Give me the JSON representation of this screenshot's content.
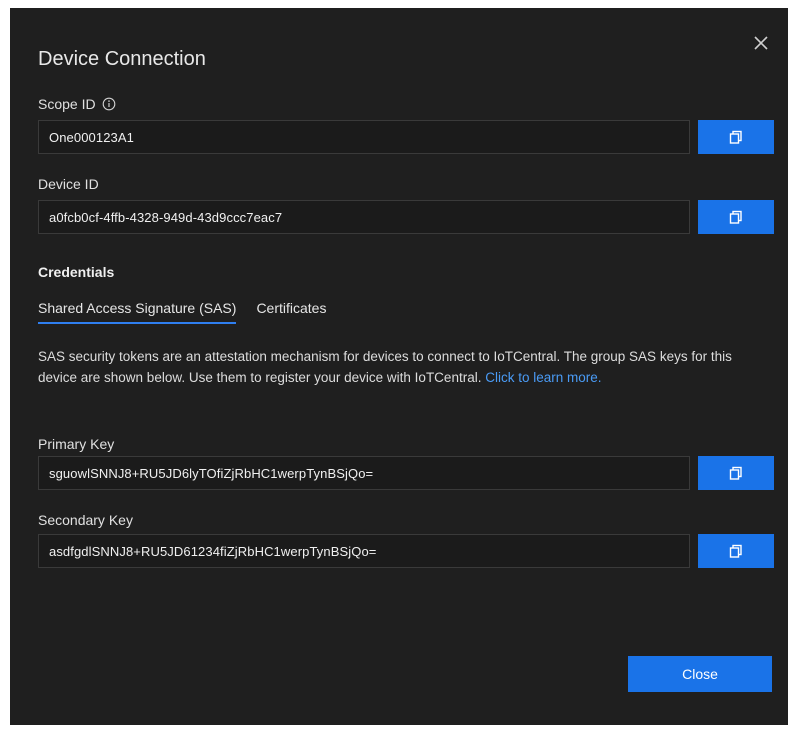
{
  "dialog": {
    "title": "Device Connection",
    "close_icon": "close-icon",
    "accent_color": "#1a73e8"
  },
  "scope": {
    "label": "Scope ID",
    "value": "One000123A1",
    "copy_icon": "copy-icon",
    "info_icon": "info-icon"
  },
  "device": {
    "label": "Device ID",
    "value": "a0fcb0cf-4ffb-4328-949d-43d9ccc7eac7",
    "copy_icon": "copy-icon"
  },
  "credentials": {
    "heading": "Credentials",
    "tabs": [
      {
        "label": "Shared Access Signature (SAS)",
        "active": true
      },
      {
        "label": "Certificates",
        "active": false
      }
    ],
    "description": "SAS security tokens are an attestation mechanism for devices to connect to IoTCentral. The group SAS keys for this device are shown below. Use them to register your device with IoTCentral. ",
    "link_text": "Click to learn more."
  },
  "primary": {
    "label": "Primary Key",
    "value": "sguowlSNNJ8+RU5JD6lyTOfiZjRbHC1werpTynBSjQo="
  },
  "secondary": {
    "label": "Secondary Key",
    "value": "asdfgdlSNNJ8+RU5JD61234fiZjRbHC1werpTynBSjQo="
  },
  "footer": {
    "close_label": "Close"
  }
}
